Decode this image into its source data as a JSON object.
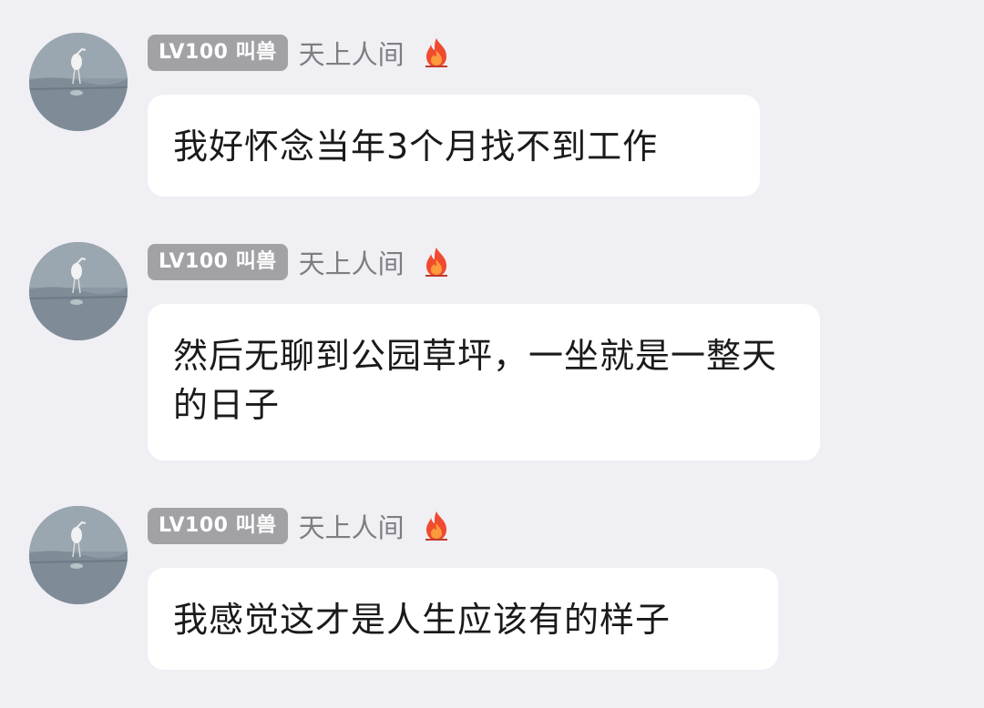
{
  "messages": [
    {
      "badge": "LV100 叫兽",
      "username": "天上人间",
      "status_icon": "fire-icon",
      "text": "我好怀念当年3个月找不到工作"
    },
    {
      "badge": "LV100 叫兽",
      "username": "天上人间",
      "status_icon": "fire-icon",
      "text": "然后无聊到公园草坪，一坐就是一整天的日子"
    },
    {
      "badge": "LV100 叫兽",
      "username": "天上人间",
      "status_icon": "fire-icon",
      "text": "我感觉这才是人生应该有的样子"
    }
  ],
  "colors": {
    "background": "#efeff4",
    "bubble": "#ffffff",
    "badge": "#a2a2a6",
    "username": "#7d7d82",
    "fire": "#f04a2f"
  }
}
